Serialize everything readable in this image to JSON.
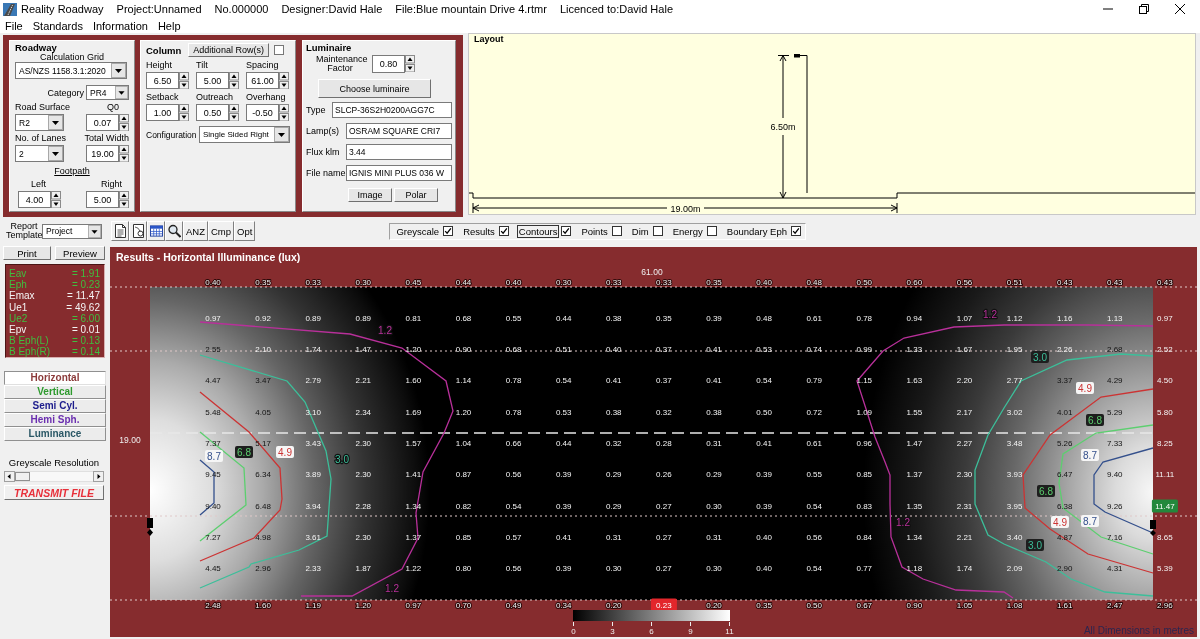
{
  "window": {
    "app_name": "Reality Roadway",
    "info": [
      "Project:Unnamed",
      "No.000000",
      "Designer:David Hale",
      "File:Blue mountain Drive 4.rtmr",
      "Licenced to:David Hale"
    ]
  },
  "menu": [
    "File",
    "Standards",
    "Information",
    "Help"
  ],
  "roadway": {
    "title": "Roadway",
    "calculation_grid": {
      "label": "Calculation Grid",
      "value": "AS/NZS 1158.3.1:2020"
    },
    "category": {
      "label": "Category",
      "value": "PR4"
    },
    "road_surface": {
      "label": "Road Surface",
      "value": "R2"
    },
    "q0": {
      "label": "Q0",
      "value": "0.07"
    },
    "lanes": {
      "label": "No. of Lanes",
      "value": "2"
    },
    "total_width": {
      "label": "Total Width",
      "value": "19.00"
    },
    "footpath": {
      "label": "Footpath",
      "left": {
        "label": "Left",
        "value": "4.00"
      },
      "right": {
        "label": "Right",
        "value": "5.00"
      }
    }
  },
  "column": {
    "title": "Column",
    "additional_rows": {
      "label": "Additional Row(s)",
      "checked": false
    },
    "fields": [
      {
        "label": "Height",
        "value": "6.50"
      },
      {
        "label": "Tilt",
        "value": "5.00"
      },
      {
        "label": "Spacing",
        "value": "61.00"
      },
      {
        "label": "Setback",
        "value": "1.00"
      },
      {
        "label": "Outreach",
        "value": "0.50"
      },
      {
        "label": "Overhang",
        "value": "-0.50"
      }
    ],
    "configuration": {
      "label": "Configuration",
      "value": "Single Sided Right"
    }
  },
  "luminaire": {
    "title": "Luminaire",
    "maintenance_factor": {
      "label": "Maintenance Factor",
      "value": "0.80"
    },
    "choose_button": "Choose luminaire",
    "fields": [
      {
        "label": "Type",
        "value": "SLCP-36S2H0200AGG7C"
      },
      {
        "label": "Lamp(s)",
        "value": "OSRAM SQUARE CRI7"
      },
      {
        "label": "Flux klm",
        "value": "3.44"
      },
      {
        "label": "File name",
        "value": "IGNIS MINI PLUS 036 W"
      }
    ],
    "buttons": [
      "Image",
      "Polar"
    ]
  },
  "layout": {
    "title": "Layout",
    "height_label": "6.50m",
    "width_label": "19.00m"
  },
  "toolbar": {
    "report_template": {
      "label": "Report Template",
      "value": "Project"
    },
    "text_buttons": [
      "ANZ",
      "Cmp",
      "Opt"
    ],
    "options": [
      {
        "label": "Greyscale",
        "checked": true,
        "focused": false
      },
      {
        "label": "Results",
        "checked": true,
        "focused": false
      },
      {
        "label": "Contours",
        "checked": true,
        "focused": true
      },
      {
        "label": "Points",
        "checked": false,
        "focused": false
      },
      {
        "label": "Dim",
        "checked": false,
        "focused": false
      },
      {
        "label": "Energy",
        "checked": false,
        "focused": false
      },
      {
        "label": "Boundary Eph",
        "checked": true,
        "focused": false
      }
    ]
  },
  "sidebar": {
    "buttons": [
      "Print",
      "Preview"
    ],
    "stats": [
      {
        "label": "Eav",
        "value": "= 1.91",
        "color": "#3fbf3f"
      },
      {
        "label": "Eph",
        "value": "= 0.23",
        "color": "#3fbf3f"
      },
      {
        "label": "Emax",
        "value": "= 11.47",
        "color": "#f4f4f4"
      },
      {
        "label": "Ue1",
        "value": "= 49.62",
        "color": "#f4f4f4"
      },
      {
        "label": "Ue2",
        "value": "= 6.00",
        "color": "#3fbf3f"
      },
      {
        "label": "Epv",
        "value": "= 0.01",
        "color": "#f4f4f4"
      },
      {
        "label": "B Eph(L)",
        "value": "= 0.13",
        "color": "#3fbf3f"
      },
      {
        "label": "B Eph(R)",
        "value": "= 0.14",
        "color": "#3fbf3f"
      }
    ],
    "tabs": [
      {
        "label": "Horizontal",
        "selected": true,
        "color": "#8b3a3a"
      },
      {
        "label": "Vertical",
        "selected": false,
        "color": "#2e9a2e"
      },
      {
        "label": "Semi Cyl.",
        "selected": false,
        "color": "#1c1c8c"
      },
      {
        "label": "Hemi Sph.",
        "selected": false,
        "color": "#6b2fb0"
      },
      {
        "label": "Luminance",
        "selected": false,
        "color": "#2b5866"
      }
    ],
    "greyscale_resolution": {
      "label": "Greyscale Resolution",
      "level": 0
    },
    "transmit_button": "TRANSMIT FILE"
  },
  "results": {
    "title": "Results - Horizontal Illuminance (lux)",
    "length_label": "61.00",
    "width_label": "19.00",
    "rows": [
      [
        "0.40",
        "0.35",
        "0.33",
        "0.30",
        "0.45",
        "0.44",
        "0.40",
        "0.30",
        "0.33",
        "0.33",
        "0.35",
        "0.40",
        "0.48",
        "0.50",
        "0.60",
        "0.56",
        "0.51",
        "0.43",
        "0.43",
        "0.43"
      ],
      [
        "0.97",
        "0.92",
        "0.89",
        "0.89",
        "0.81",
        "0.68",
        "0.55",
        "0.44",
        "0.38",
        "0.35",
        "0.39",
        "0.48",
        "0.61",
        "0.78",
        "0.94",
        "1.07",
        "1.12",
        "1.16",
        "1.13",
        "0.97"
      ],
      [
        "2.55",
        "2.10",
        "1.74",
        "1.47",
        "1.20",
        "0.90",
        "0.68",
        "0.51",
        "0.40",
        "0.37",
        "0.41",
        "0.53",
        "0.74",
        "0.99",
        "1.33",
        "1.67",
        "1.95",
        "2.26",
        "2.68",
        "2.52"
      ],
      [
        "4.47",
        "3.47",
        "2.79",
        "2.21",
        "1.60",
        "1.14",
        "0.78",
        "0.54",
        "0.41",
        "0.37",
        "0.41",
        "0.54",
        "0.79",
        "1.15",
        "1.63",
        "2.20",
        "2.77",
        "3.37",
        "4.29",
        "4.50"
      ],
      [
        "5.48",
        "4.05",
        "3.10",
        "2.34",
        "1.69",
        "1.20",
        "0.78",
        "0.53",
        "0.38",
        "0.32",
        "0.38",
        "0.50",
        "0.72",
        "1.09",
        "1.55",
        "2.17",
        "3.02",
        "4.01",
        "5.29",
        "5.80"
      ],
      [
        "7.37",
        "5.17",
        "3.43",
        "2.30",
        "1.57",
        "1.04",
        "0.66",
        "0.44",
        "0.32",
        "0.28",
        "0.31",
        "0.41",
        "0.61",
        "0.96",
        "1.47",
        "2.27",
        "3.48",
        "5.26",
        "7.33",
        "8.25"
      ],
      [
        "9.45",
        "6.34",
        "3.89",
        "2.30",
        "1.41",
        "0.87",
        "0.56",
        "0.39",
        "0.29",
        "0.26",
        "0.29",
        "0.39",
        "0.55",
        "0.85",
        "1.37",
        "2.30",
        "3.93",
        "6.47",
        "9.40",
        "11.11"
      ],
      [
        "9.40",
        "6.48",
        "3.94",
        "2.28",
        "1.34",
        "0.82",
        "0.54",
        "0.39",
        "0.29",
        "0.27",
        "0.30",
        "0.39",
        "0.54",
        "0.83",
        "1.35",
        "2.31",
        "3.95",
        "6.38",
        "9.26",
        {
          "text": "11.47",
          "kind": "max"
        }
      ],
      [
        "7.27",
        "4.98",
        "3.61",
        "2.30",
        "1.37",
        "0.85",
        "0.57",
        "0.41",
        "0.31",
        "0.27",
        "0.31",
        "0.40",
        "0.56",
        "0.84",
        "1.34",
        "2.21",
        "3.40",
        "4.87",
        "7.16",
        "8.65"
      ],
      [
        "4.45",
        "2.96",
        "2.33",
        "1.87",
        "1.22",
        "0.80",
        "0.56",
        "0.39",
        "0.30",
        "0.27",
        "0.30",
        "0.40",
        "0.54",
        "0.77",
        "1.18",
        "1.74",
        "2.09",
        "2.90",
        "4.31",
        "5.39"
      ],
      [
        "2.48",
        "1.60",
        "1.19",
        "1.20",
        "0.97",
        "0.70",
        "0.49",
        "0.34",
        "0.20",
        {
          "text": "0.23",
          "kind": "min"
        },
        "0.20",
        "0.35",
        "0.50",
        "0.67",
        "0.90",
        "1.05",
        "1.08",
        "1.61",
        "2.47",
        "2.96"
      ]
    ],
    "contours": [
      {
        "labels": [
          "1.2",
          "1.2",
          "1.2",
          "1.2"
        ],
        "color": "#b8309a"
      },
      {
        "labels": [
          "3.0",
          "3.0",
          "3.0"
        ],
        "color": "#3cbf9a"
      },
      {
        "labels": [
          "4.9",
          "4.9",
          "4.9"
        ],
        "color": "#cc3333"
      },
      {
        "labels": [
          "6.8",
          "6.8",
          "6.8"
        ],
        "color": "#5ccf6f"
      },
      {
        "labels": [
          "8.7",
          "8.7",
          "8.7"
        ],
        "color": "#34508c"
      }
    ],
    "scale_ticks": [
      "0",
      "3",
      "6",
      "9",
      "11"
    ],
    "footnote": "All Dimensions in metres"
  }
}
